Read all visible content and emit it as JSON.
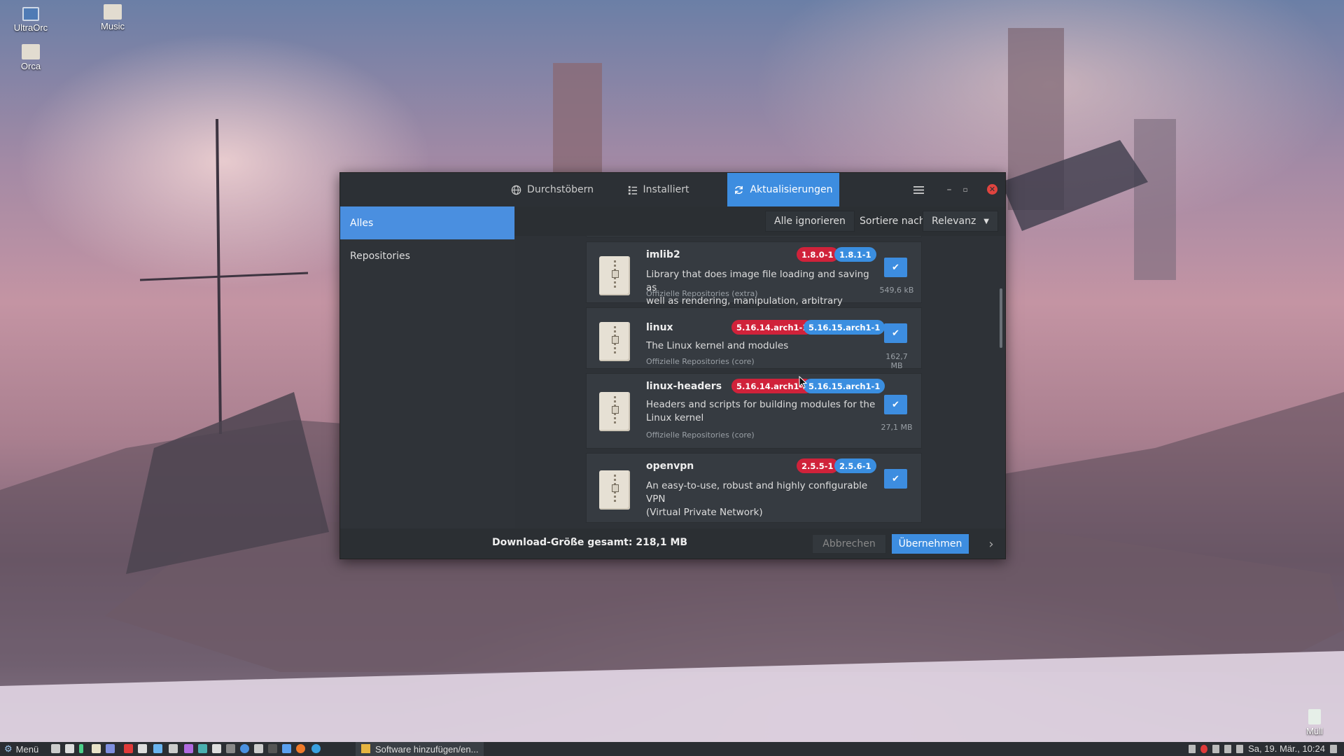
{
  "desktop": {
    "icons": [
      {
        "label": "UltraOrc"
      },
      {
        "label": "Music"
      },
      {
        "label": "Orca"
      },
      {
        "label": "Müll"
      }
    ]
  },
  "window": {
    "tabs": [
      {
        "label": "Durchstöbern",
        "icon": "globe-icon"
      },
      {
        "label": "Installiert",
        "icon": "list-icon"
      },
      {
        "label": "Aktualisierungen",
        "icon": "refresh-icon"
      }
    ],
    "sidebar": [
      {
        "label": "Alles"
      },
      {
        "label": "Repositories"
      }
    ],
    "toolbar": {
      "ignore_all": "Alle ignorieren",
      "sort_label": "Sortiere nach",
      "sort_value": "Relevanz"
    },
    "packages": [
      {
        "name": "imlib2",
        "old": "1.8.0-1",
        "new": "1.8.1-1",
        "desc_line1": "Library that does image file loading and saving as",
        "desc_line2": "well as rendering, manipulation, arbitrary polygon ...",
        "repo": "Offizielle Repositories (extra)",
        "size": "549,6 kB"
      },
      {
        "name": "linux",
        "old": "5.16.14.arch1-1",
        "new": "5.16.15.arch1-1",
        "desc_line1": "The Linux kernel and modules",
        "desc_line2": "",
        "repo": "Offizielle Repositories (core)",
        "size": "162,7 MB"
      },
      {
        "name": "linux-headers",
        "old": "5.16.14.arch1-1",
        "new": "5.16.15.arch1-1",
        "desc_line1": "Headers and scripts for building modules for the",
        "desc_line2": "Linux kernel",
        "repo": "Offizielle Repositories (core)",
        "size": "27,1 MB"
      },
      {
        "name": "openvpn",
        "old": "2.5.5-1",
        "new": "2.5.6-1",
        "desc_line1": "An easy-to-use, robust and highly configurable VPN",
        "desc_line2": "(Virtual Private Network)",
        "repo": "",
        "size": ""
      }
    ],
    "footer": {
      "download_total": "Download-Größe gesamt: 218,1 MB",
      "cancel": "Abbrechen",
      "apply": "Übernehmen"
    }
  },
  "taskbar": {
    "menu_label": "Menü",
    "task_label": "Software hinzufügen/en...",
    "clock": "Sa, 19. Mär., 10:24"
  },
  "colors": {
    "accent": "#3d8de0",
    "old_version": "#d0223a",
    "new_version": "#3a8ee0",
    "window_bg": "#32373c"
  }
}
